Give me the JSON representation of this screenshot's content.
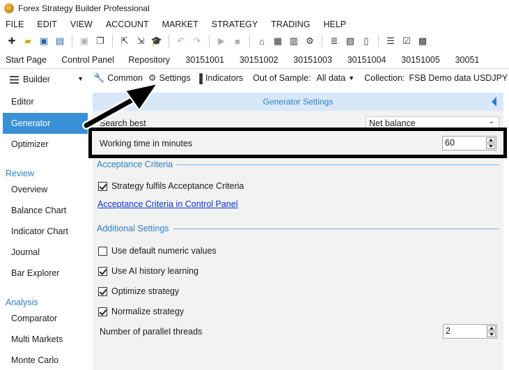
{
  "window": {
    "title": "Forex Strategy Builder Professional"
  },
  "menu": [
    "FILE",
    "EDIT",
    "VIEW",
    "ACCOUNT",
    "MARKET",
    "STRATEGY",
    "TRADING",
    "HELP"
  ],
  "toolbar_icons": [
    "new-strategy-icon",
    "open-folder-icon",
    "save-icon",
    "save-as-icon",
    "save-disabled-icon",
    "copy-strategy-icon",
    "export-icon",
    "import-icon",
    "graduation-cap-icon",
    "undo-icon",
    "redo-icon",
    "play-icon",
    "stop-icon",
    "home-icon",
    "data-icon",
    "calendar-icon",
    "gear-icon",
    "list-icon",
    "collection-icon",
    "document-icon",
    "align-icon",
    "checklist-icon",
    "briefcase-icon"
  ],
  "tabs": [
    "Start Page",
    "Control Panel",
    "Repository",
    "30151001",
    "30151002",
    "30151003",
    "30151004",
    "30151005",
    "30051"
  ],
  "builder_dropdown": {
    "label": "Builder"
  },
  "subtoolbar": {
    "common": "Common",
    "settings": "Settings",
    "indicators": "Indicators",
    "oos_label": "Out of Sample:",
    "oos_value": "All data",
    "collection_label": "Collection:",
    "collection_value": "FSB Demo data USDJPY"
  },
  "sidebar": {
    "items_top": [
      "Editor",
      "Generator",
      "Optimizer"
    ],
    "selected": "Generator",
    "review_header": "Review",
    "review_items": [
      "Overview",
      "Balance Chart",
      "Indicator Chart",
      "Journal",
      "Bar Explorer"
    ],
    "analysis_header": "Analysis",
    "analysis_items": [
      "Comparator",
      "Multi Markets",
      "Monte Carlo"
    ]
  },
  "generator_settings": {
    "header": "Generator Settings",
    "search_best_label": "Search best",
    "search_best_value": "Net balance",
    "working_time_label": "Working time in minutes",
    "working_time_value": "60",
    "acceptance_header": "Acceptance Criteria",
    "acceptance_checkbox": {
      "label": "Strategy fulfils Acceptance Criteria",
      "checked": true
    },
    "acceptance_link": "Acceptance Criteria in Control Panel",
    "additional_header": "Additional Settings",
    "options": [
      {
        "label": "Use default numeric values",
        "checked": false
      },
      {
        "label": "Use AI history learning",
        "checked": true
      },
      {
        "label": "Optimize strategy",
        "checked": true
      },
      {
        "label": "Normalize strategy",
        "checked": true
      }
    ],
    "threads_label": "Number of parallel threads",
    "threads_value": "2"
  },
  "colors": {
    "accent": "#3a90d6",
    "header_bg": "#d9e8f8",
    "link": "#0a35c8",
    "panel_bg": "#f2f2f2"
  }
}
